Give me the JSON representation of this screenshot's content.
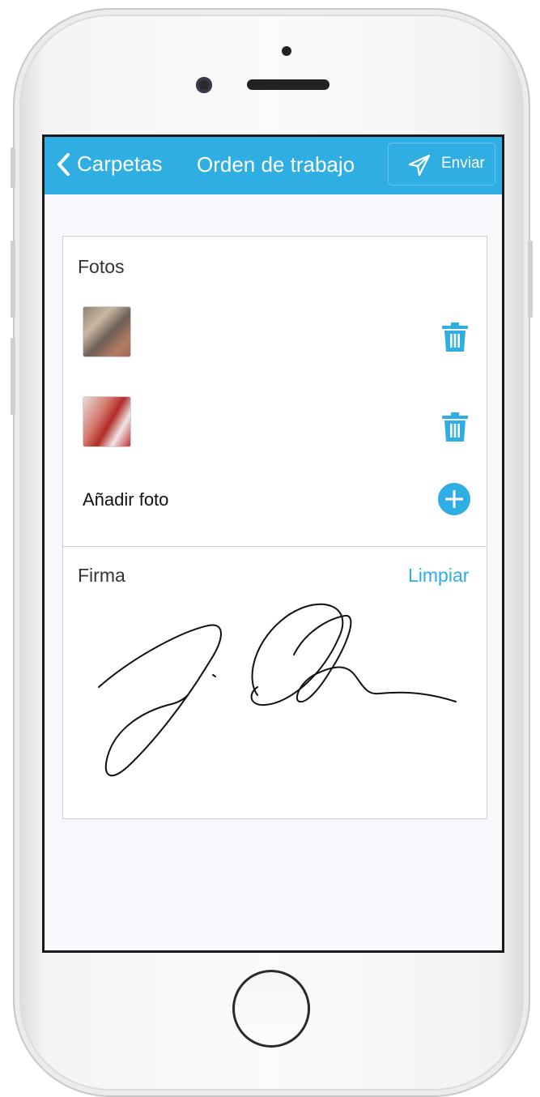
{
  "navbar": {
    "back_label": "Carpetas",
    "title": "Orden de trabajo",
    "send_label": "Enviar",
    "background": "#2eaee3"
  },
  "photos": {
    "title": "Fotos",
    "items": [
      {
        "thumbnail": "photo-thumbnail"
      },
      {
        "thumbnail": "photo-thumbnail"
      }
    ],
    "add_label": "Añadir foto"
  },
  "signature": {
    "title": "Firma",
    "clear_label": "Limpiar"
  },
  "icons": {
    "back": "chevron-left-icon",
    "send": "paper-plane-icon",
    "delete": "trash-icon",
    "add": "plus-circle-icon"
  },
  "accent_color": "#2eaee3"
}
